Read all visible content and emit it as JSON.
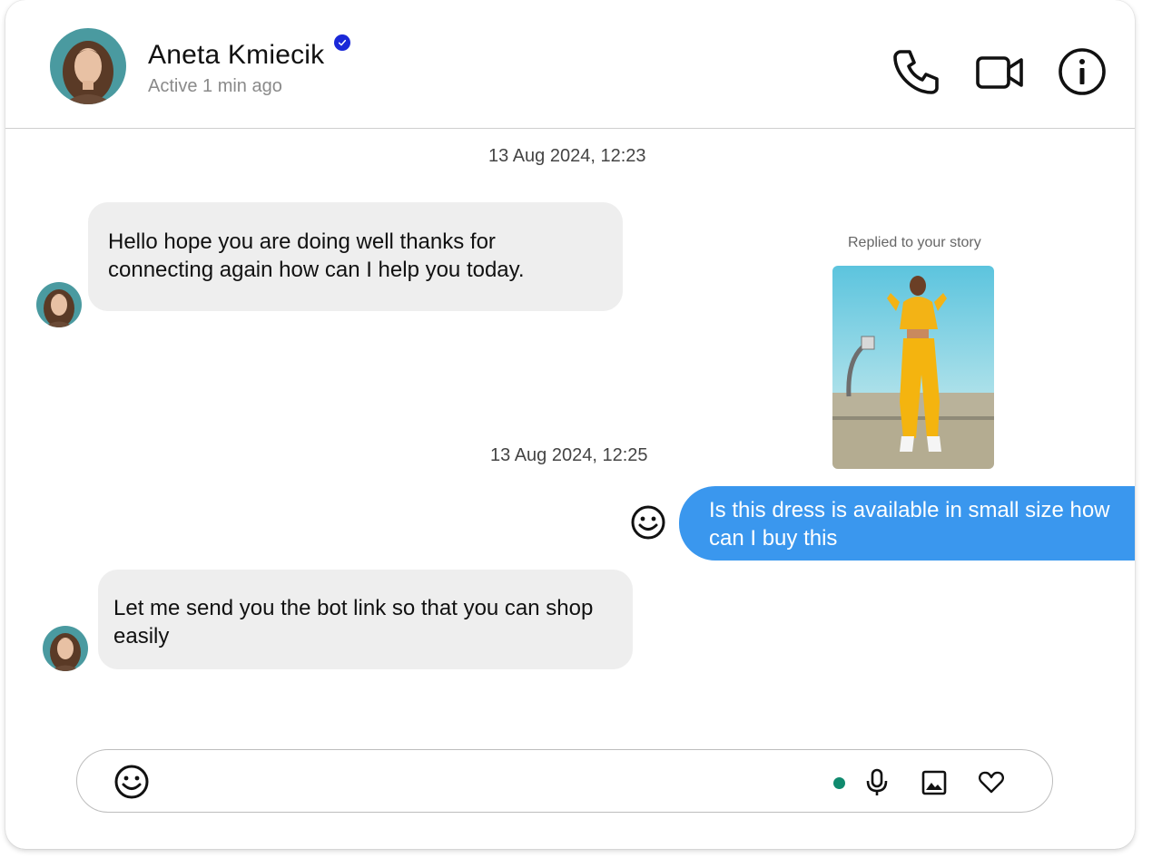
{
  "header": {
    "contact_name": "Aneta Kmiecik",
    "verified": true,
    "status": "Active 1 min ago",
    "actions": [
      {
        "name": "call",
        "icon": "phone-icon"
      },
      {
        "name": "video-call",
        "icon": "video-camera-icon"
      },
      {
        "name": "info",
        "icon": "info-icon"
      }
    ]
  },
  "conversation": {
    "timestamp_1": "13 Aug 2024, 12:23",
    "message_1": "Hello hope you are doing well thanks for connecting again how can I help you today.",
    "story_reply_label": "Replied to your story",
    "timestamp_2": "13 Aug 2024, 12:25",
    "message_2": "Is this dress is available in small size how can I buy this",
    "message_3": "Let me send you the bot link so that you can shop easily"
  },
  "composer": {
    "placeholder": "",
    "icons": [
      "emoji-icon",
      "microphone-icon",
      "image-icon",
      "heart-icon"
    ]
  },
  "colors": {
    "outgoing_bubble": "#3a97ee",
    "incoming_bubble": "#eeeeee",
    "verified_badge": "#1a28d8",
    "online_dot": "#108a6e"
  }
}
